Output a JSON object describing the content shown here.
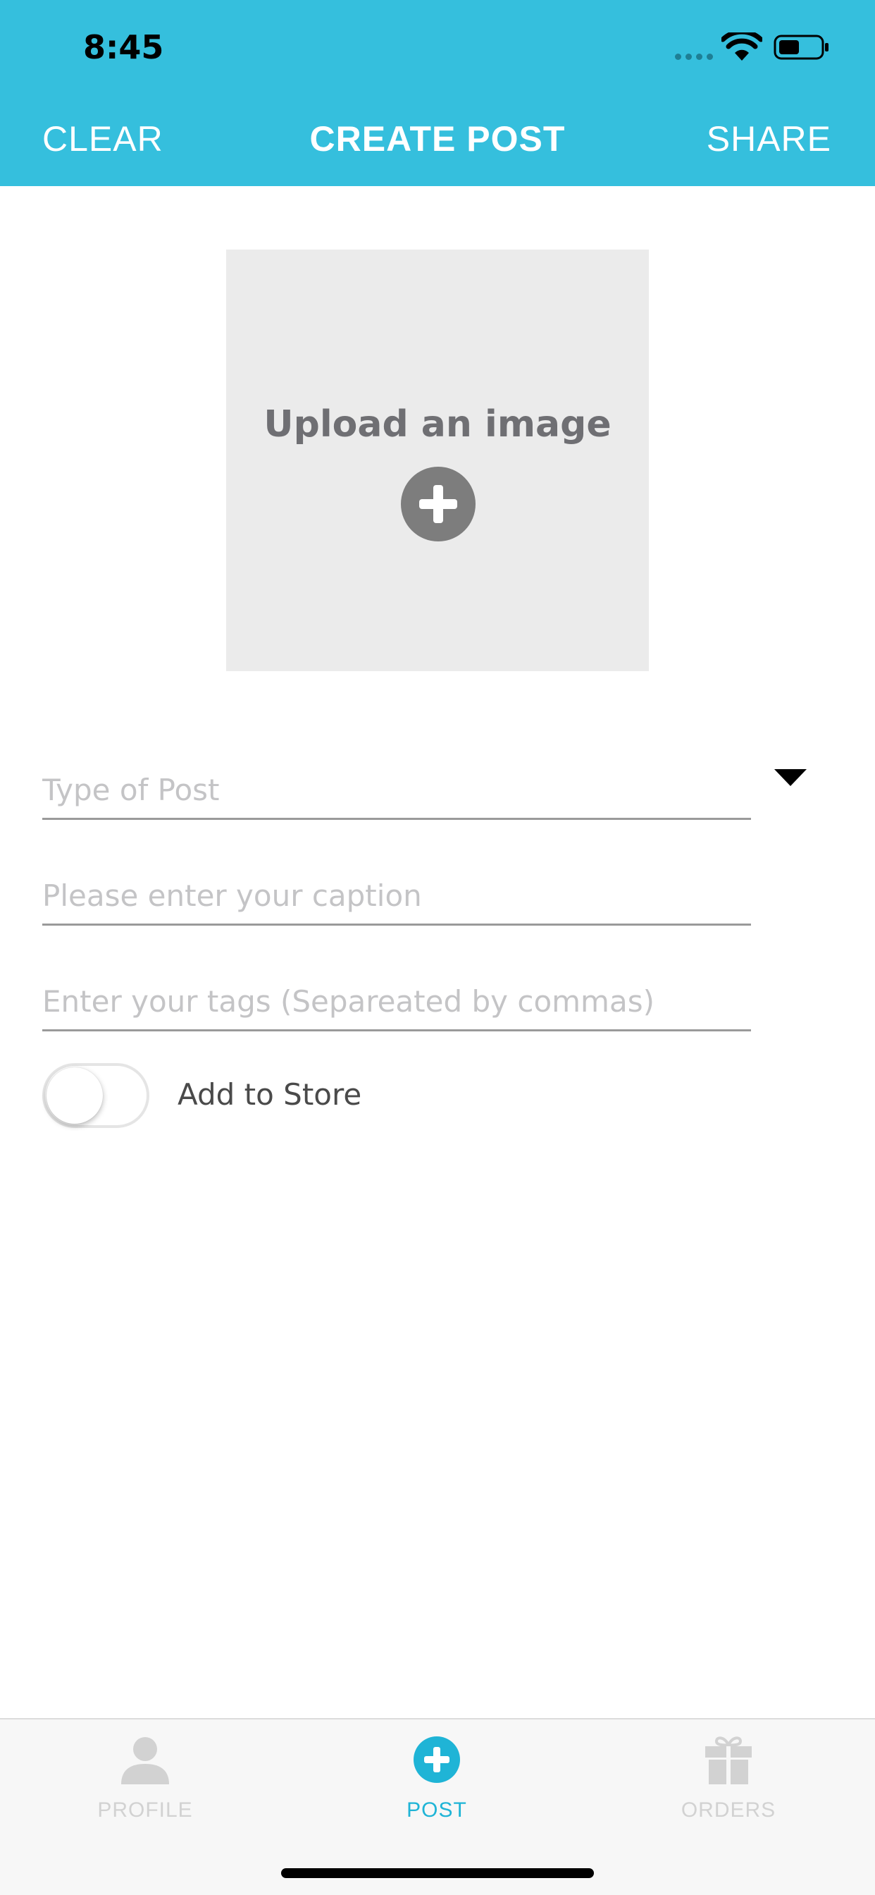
{
  "status_bar": {
    "time": "8:45",
    "icons": [
      "signal-dots-icon",
      "wifi-icon",
      "battery-icon"
    ]
  },
  "header": {
    "clear_label": "CLEAR",
    "title": "CREATE POST",
    "share_label": "SHARE",
    "background_color": "#35bfdd"
  },
  "upload": {
    "label": "Upload an image",
    "icon": "plus-circle-icon"
  },
  "form": {
    "type_placeholder": "Type of Post",
    "type_value": "",
    "caption_placeholder": "Please enter your caption",
    "caption_value": "",
    "tags_placeholder": "Enter your tags (Separeated by commas)",
    "tags_value": "",
    "store_toggle_label": "Add to Store",
    "store_toggle_on": false
  },
  "tabbar": {
    "items": [
      {
        "label": "PROFILE",
        "icon": "person-icon",
        "active": false
      },
      {
        "label": "POST",
        "icon": "plus-circle-icon",
        "active": true
      },
      {
        "label": "ORDERS",
        "icon": "gift-icon",
        "active": false
      }
    ],
    "active_color": "#1fb4d6",
    "inactive_color": "#d2d2d2"
  }
}
